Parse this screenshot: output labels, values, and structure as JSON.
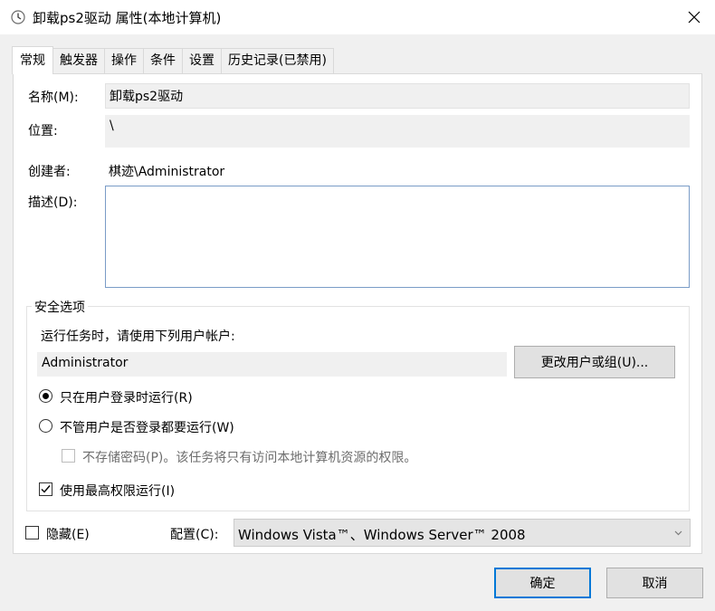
{
  "window": {
    "title": "卸载ps2驱动 属性(本地计算机)"
  },
  "tabs": [
    {
      "label": "常规",
      "active": true
    },
    {
      "label": "触发器",
      "active": false
    },
    {
      "label": "操作",
      "active": false
    },
    {
      "label": "条件",
      "active": false
    },
    {
      "label": "设置",
      "active": false
    },
    {
      "label": "历史记录(已禁用)",
      "active": false
    }
  ],
  "general": {
    "name_label": "名称(M):",
    "name_value": "卸载ps2驱动",
    "location_label": "位置:",
    "location_value": "\\",
    "author_label": "创建者:",
    "author_value": "棋迹\\Administrator",
    "description_label": "描述(D):",
    "description_value": ""
  },
  "security": {
    "group_title": "安全选项",
    "run_as_prompt": "运行任务时，请使用下列用户帐户:",
    "user_account": "Administrator",
    "change_user_button": "更改用户或组(U)...",
    "radio_logged_on": "只在用户登录时运行(R)",
    "radio_logged_on_checked": true,
    "radio_whether_logged": "不管用户是否登录都要运行(W)",
    "radio_whether_logged_checked": false,
    "no_store_password": "不存储密码(P)。该任务将只有访问本地计算机资源的权限。",
    "no_store_password_checked": false,
    "highest_privileges": "使用最高权限运行(I)",
    "highest_privileges_checked": true
  },
  "bottom": {
    "hidden_label": "隐藏(E)",
    "hidden_checked": false,
    "configure_label": "配置(C):",
    "configure_value": "Windows Vista™、Windows Server™ 2008"
  },
  "buttons": {
    "ok": "确定",
    "cancel": "取消"
  },
  "colors": {
    "accent": "#0078d7",
    "window_bg": "#f0f0f0",
    "panel_bg": "#ffffff"
  },
  "icons": {
    "title": "clock-icon",
    "close": "close-icon",
    "check": "checkmark-icon",
    "dropdown": "chevron-down-icon"
  }
}
